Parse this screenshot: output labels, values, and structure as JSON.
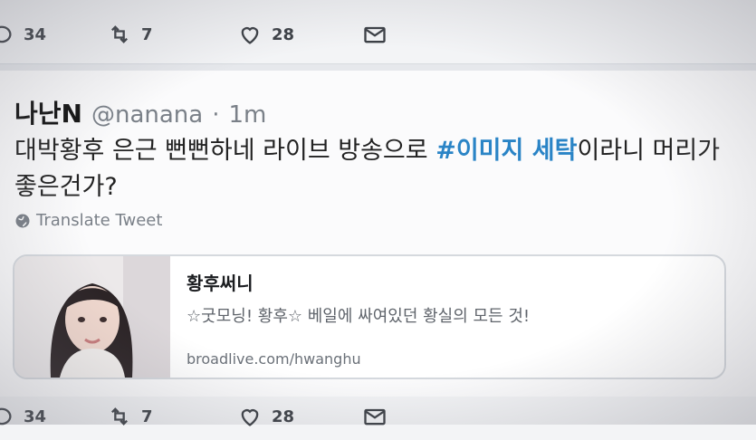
{
  "top_actions": {
    "replies": "34",
    "retweets": "7",
    "likes": "28"
  },
  "bottom_actions": {
    "replies": "34",
    "retweets": "7",
    "likes": "28"
  },
  "tweet": {
    "name": "나난N",
    "handle": "@nanana",
    "dot": "·",
    "time": "1m",
    "text_before": "대박황후 은근 뻔뻔하네 라이브 방송으로 ",
    "hashtag": "#이미지 세탁",
    "text_after": "이라니 머리가 좋은건가?",
    "translate_label": "Translate Tweet"
  },
  "card": {
    "title": "황후써니",
    "description": "☆굿모닝! 황후☆ 베일에 싸여있던 황실의 모든 것!",
    "link": "broadlive.com/hwanghu"
  },
  "colors": {
    "hashtag": "#2a84c6",
    "background": "#f3f4f6"
  },
  "icons": [
    "reply-icon",
    "retweet-icon",
    "like-icon",
    "dm-icon",
    "globe-icon"
  ]
}
